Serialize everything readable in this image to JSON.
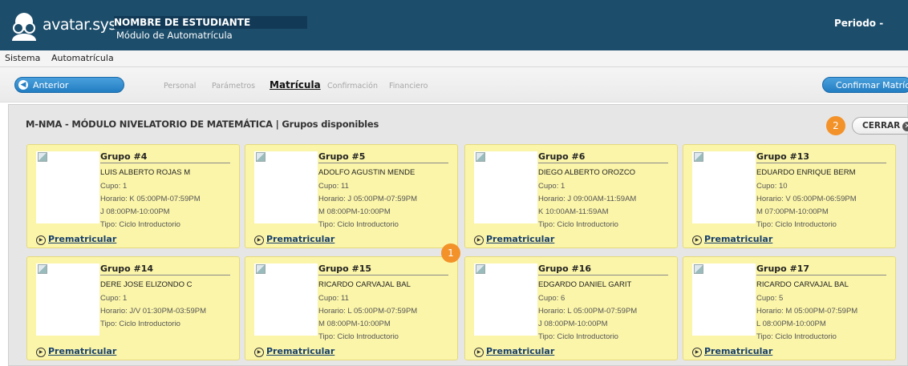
{
  "header": {
    "brand": "avatar.sys",
    "student_name": "NOMBRE DE ESTUDIANTE",
    "module_name": "Módulo de Automatrícula",
    "period_label": "Periodo -"
  },
  "menu": {
    "items": [
      "Sistema",
      "Automatrícula"
    ]
  },
  "stepbar": {
    "prev_label": "Anterior",
    "confirm_label": "Confirmar Matrícula",
    "steps": [
      {
        "label": "Personal",
        "active": false
      },
      {
        "label": "Parámetros",
        "active": false
      },
      {
        "label": "Matrícula",
        "active": true
      },
      {
        "label": "Confirmación",
        "active": false
      },
      {
        "label": "Financiero",
        "active": false
      }
    ]
  },
  "panel": {
    "title": "M-NMA - MÓDULO NIVELATORIO DE MATEMÁTICA | Grupos disponibles",
    "close_label": "CERRAR",
    "badge1": "1",
    "badge2": "2",
    "prematricular_label": "Prematricular",
    "groups": [
      {
        "title": "Grupo #4",
        "teacher": "LUIS ALBERTO ROJAS M",
        "cupo": "Cupo: 1",
        "horario": "Horario: K 05:00PM-07:59PM",
        "horario2": "J 08:00PM-10:00PM",
        "tipo": "Tipo: Ciclo Introductorio"
      },
      {
        "title": "Grupo #5",
        "teacher": "ADOLFO AGUSTIN MENDE",
        "cupo": "Cupo: 11",
        "horario": "Horario: J 05:00PM-07:59PM",
        "horario2": "M 08:00PM-10:00PM",
        "tipo": "Tipo: Ciclo Introductorio"
      },
      {
        "title": "Grupo #6",
        "teacher": "DIEGO ALBERTO OROZCO",
        "cupo": "Cupo: 1",
        "horario": "Horario: J 09:00AM-11:59AM",
        "horario2": "K 10:00AM-11:59AM",
        "tipo": "Tipo: Ciclo Introductorio"
      },
      {
        "title": "Grupo #13",
        "teacher": "EDUARDO ENRIQUE BERM",
        "cupo": "Cupo: 10",
        "horario": "Horario: V 05:00PM-06:59PM",
        "horario2": "M 07:00PM-10:00PM",
        "tipo": "Tipo: Ciclo Introductorio"
      },
      {
        "title": "Grupo #14",
        "teacher": "DERE JOSE ELIZONDO C",
        "cupo": "Cupo: 1",
        "horario": "Horario: J/V 01:30PM-03:59PM",
        "horario2": "",
        "tipo": "Tipo: Ciclo Introductorio"
      },
      {
        "title": "Grupo #15",
        "teacher": "RICARDO CARVAJAL BAL",
        "cupo": "Cupo: 11",
        "horario": "Horario: L 05:00PM-07:59PM",
        "horario2": "M 08:00PM-10:00PM",
        "tipo": "Tipo: Ciclo Introductorio"
      },
      {
        "title": "Grupo #16",
        "teacher": "EDGARDO DANIEL GARIT",
        "cupo": "Cupo: 6",
        "horario": "Horario: L 05:00PM-07:59PM",
        "horario2": "J 08:00PM-10:00PM",
        "tipo": "Tipo: Ciclo Introductorio"
      },
      {
        "title": "Grupo #17",
        "teacher": "RICARDO CARVAJAL BAL",
        "cupo": "Cupo: 5",
        "horario": "Horario: M 05:00PM-07:59PM",
        "horario2": "L 08:00PM-10:00PM",
        "tipo": "Tipo: Ciclo Introductorio"
      }
    ]
  },
  "colors": {
    "header_bg": "#1c4d6b",
    "accent_blue": "#237ec2",
    "card_bg": "#fbf5a9",
    "badge_orange": "#f39229"
  }
}
